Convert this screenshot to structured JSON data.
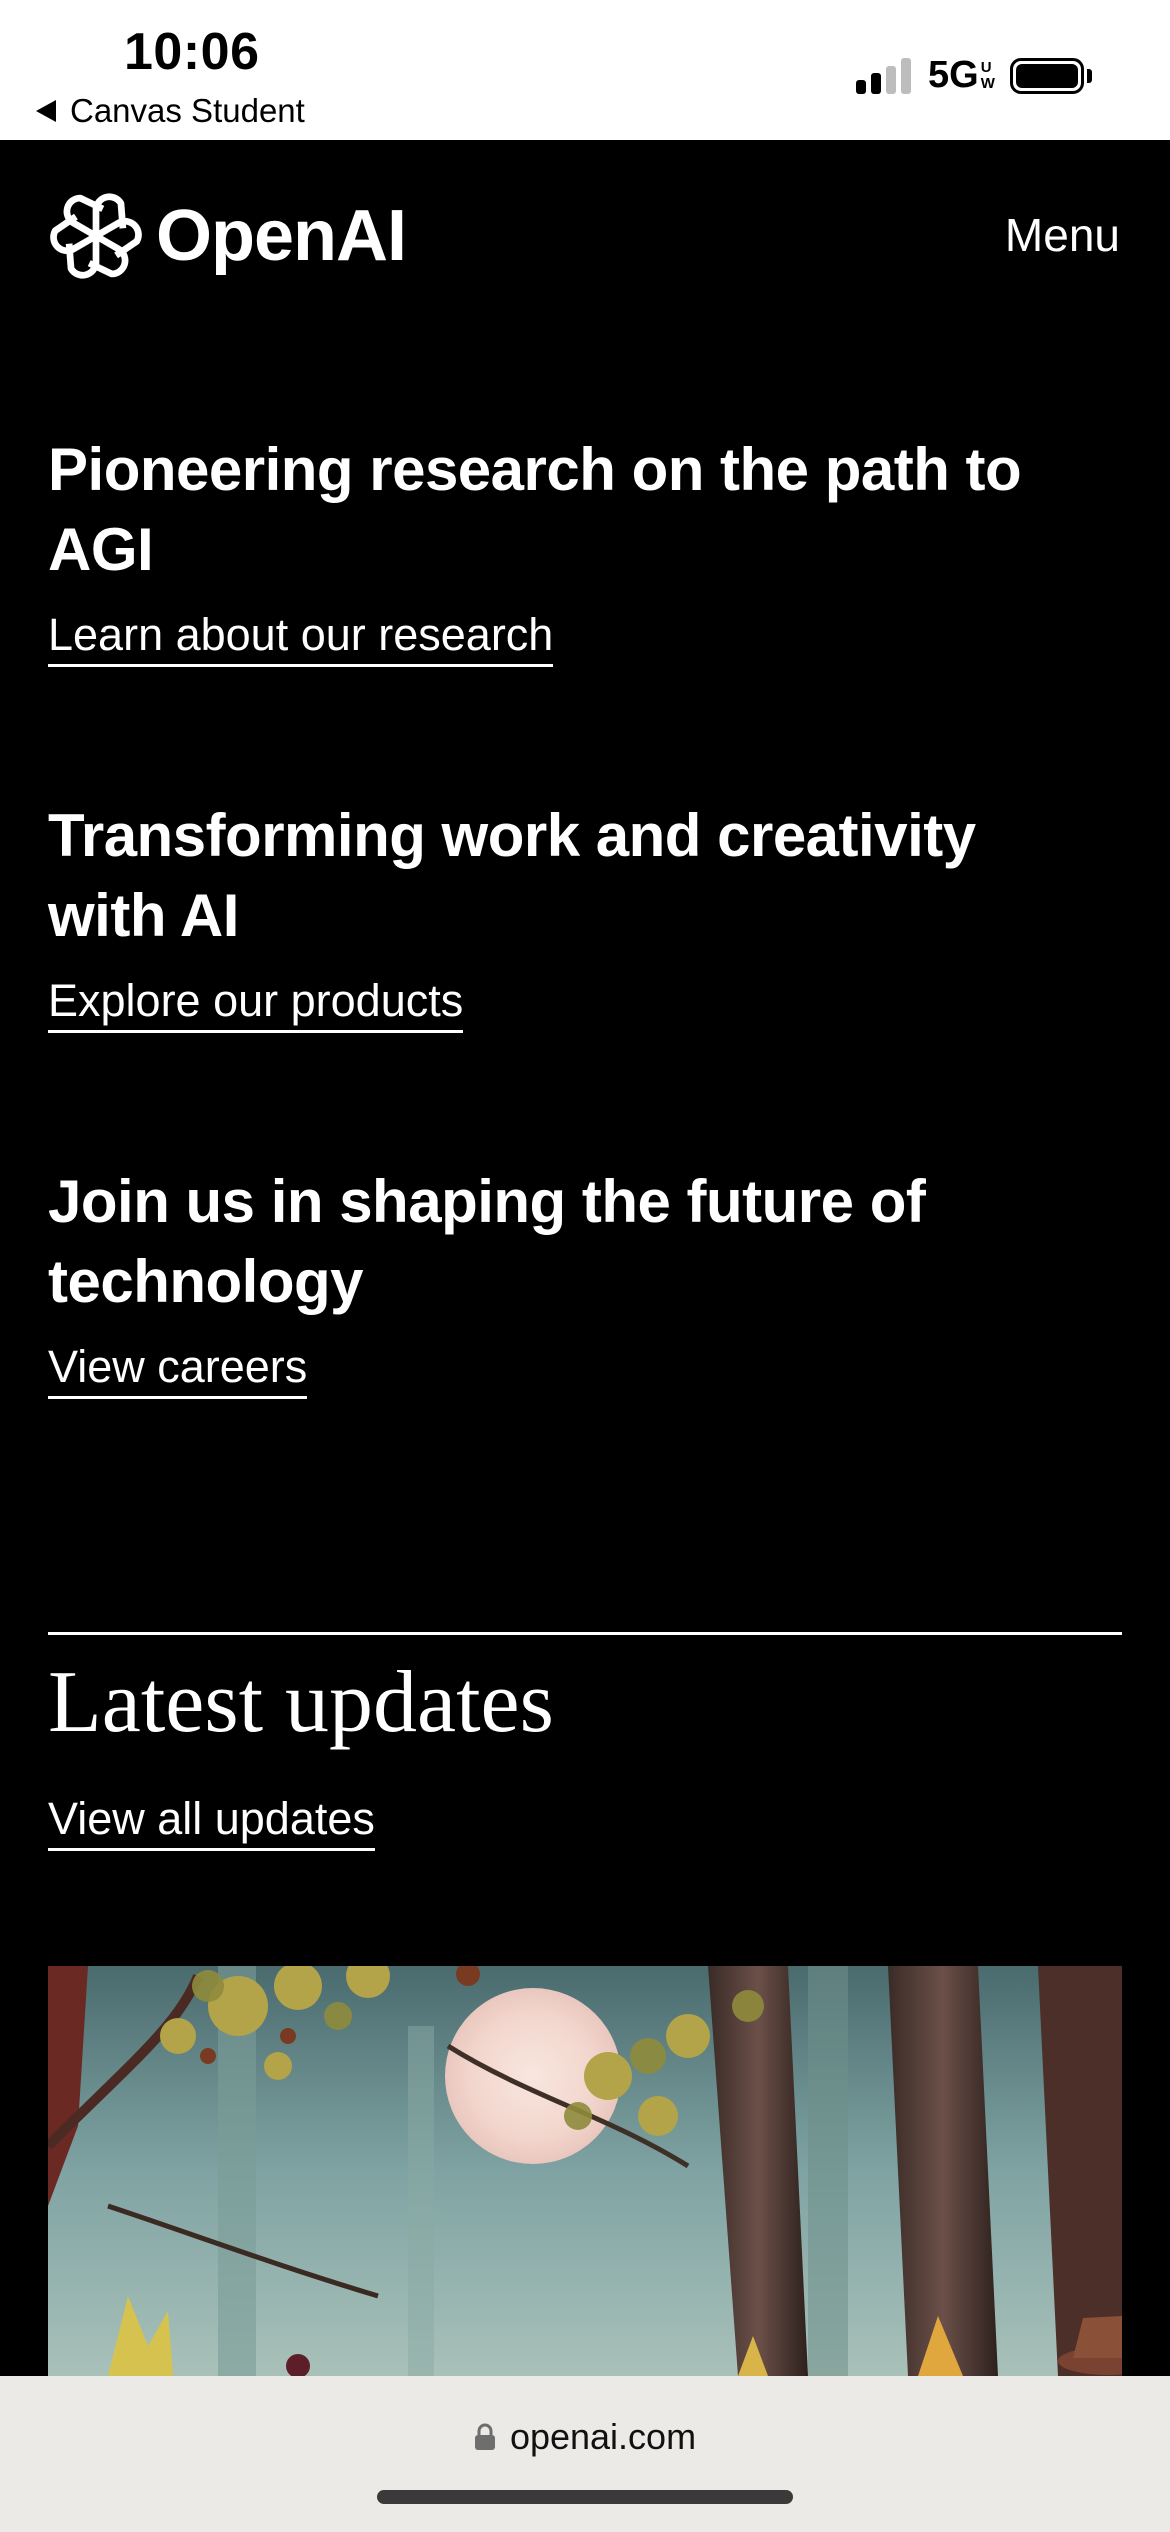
{
  "status_bar": {
    "time": "10:06",
    "back_app": "Canvas Student",
    "network": "5G",
    "network_sub": [
      "U",
      "W"
    ]
  },
  "header": {
    "brand": "OpenAI",
    "menu_label": "Menu"
  },
  "sections": [
    {
      "heading": "Pioneering research on the path to AGI",
      "link": "Learn about our research"
    },
    {
      "heading": "Transforming work and creativity with AI",
      "link": "Explore our products"
    },
    {
      "heading": "Join us in shaping the future of technology",
      "link": "View careers"
    }
  ],
  "updates": {
    "title": "Latest updates",
    "link": "View all updates"
  },
  "browser": {
    "url": "openai.com"
  },
  "colors": {
    "page_bg": "#000000",
    "text": "#ffffff",
    "status_bg": "#ffffff",
    "browser_bar_bg": "#eceae7"
  }
}
